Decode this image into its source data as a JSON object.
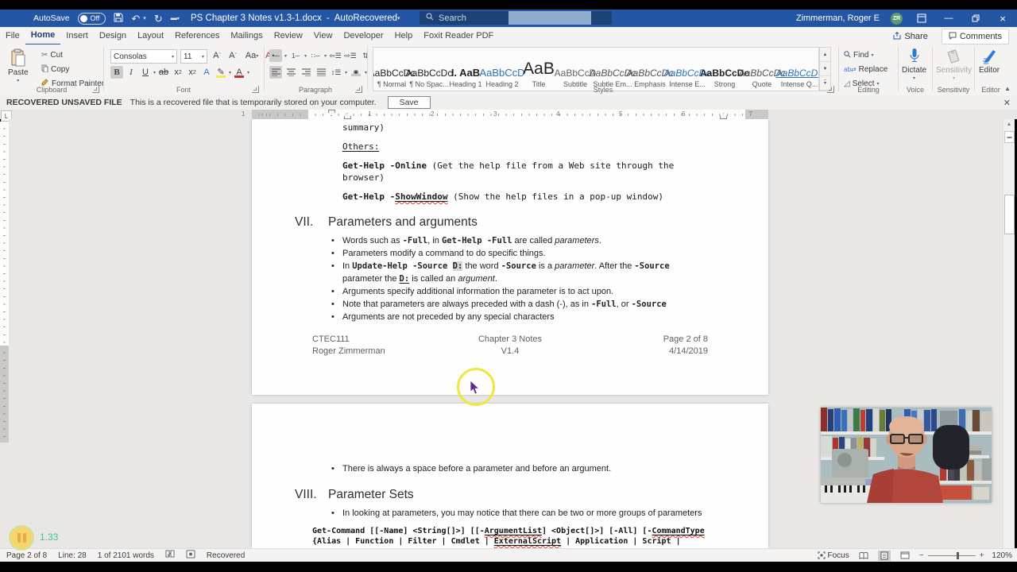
{
  "titlebar": {
    "autosave_label": "AutoSave",
    "autosave_state": "Off",
    "title": "PS Chapter 3 Notes v1.3-1.docx",
    "title_separator": "-",
    "title_suffix": "AutoRecovered",
    "search_placeholder": "Search",
    "user_name": "Zimmerman, Roger E",
    "user_initials": "ZR"
  },
  "tabs": {
    "items": [
      "File",
      "Home",
      "Insert",
      "Design",
      "Layout",
      "References",
      "Mailings",
      "Review",
      "View",
      "Developer",
      "Help",
      "Foxit Reader PDF"
    ],
    "active": "Home",
    "share_label": "Share",
    "comments_label": "Comments"
  },
  "ribbon": {
    "clipboard": {
      "label": "Clipboard",
      "paste": "Paste",
      "cut": "Cut",
      "copy": "Copy",
      "format_painter": "Format Painter"
    },
    "font": {
      "label": "Font",
      "family": "Consolas",
      "size": "11"
    },
    "paragraph": {
      "label": "Paragraph"
    },
    "styles": {
      "label": "Styles",
      "items": [
        {
          "preview": "AaBbCcDc",
          "name": "¶ Normal",
          "kind": "normal"
        },
        {
          "preview": "AaBbCcDc",
          "name": "¶ No Spac...",
          "kind": "normal"
        },
        {
          "preview": "I. AaB",
          "name": "Heading 1",
          "kind": "h1"
        },
        {
          "preview": "AaBbCcD",
          "name": "Heading 2",
          "kind": "h2"
        },
        {
          "preview": "AaB",
          "name": "Title",
          "kind": "title"
        },
        {
          "preview": "AaBbCcD",
          "name": "Subtitle",
          "kind": "subtitle"
        },
        {
          "preview": "AaBbCcDc",
          "name": "Subtle Em...",
          "kind": "it"
        },
        {
          "preview": "AaBbCcDc",
          "name": "Emphasis",
          "kind": "it"
        },
        {
          "preview": "AaBbCcDc",
          "name": "Intense E...",
          "kind": "itblue"
        },
        {
          "preview": "AaBbCcDc",
          "name": "Strong",
          "kind": "bold"
        },
        {
          "preview": "AaBbCcDc",
          "name": "Quote",
          "kind": "it"
        },
        {
          "preview": "AaBbCcDc",
          "name": "Intense Q...",
          "kind": "intq"
        }
      ]
    },
    "editing": {
      "label": "Editing",
      "find": "Find",
      "replace": "Replace",
      "select": "Select"
    },
    "voice": {
      "label": "Voice",
      "dictate": "Dictate"
    },
    "sensitivity": {
      "label": "Sensitivity",
      "button": "Sensitivity"
    },
    "editor": {
      "label": "Editor",
      "button": "Editor"
    }
  },
  "recovered_bar": {
    "title": "RECOVERED UNSAVED FILE",
    "message": "This is a recovered file that is temporarily stored on your computer.",
    "save_label": "Save"
  },
  "ruler": {
    "left_margin_number": "1",
    "numbers": [
      "1",
      "2",
      "3",
      "4",
      "5",
      "6"
    ],
    "right_margin_number": "7",
    "tab_selector": "L"
  },
  "document": {
    "page1_blocks": [
      {
        "type": "mono",
        "cls": "first",
        "lines": [
          [
            {
              "t": "summary)"
            }
          ]
        ]
      },
      {
        "type": "mono",
        "lines": [
          [
            {
              "t": "Others:",
              "u": 1
            }
          ]
        ]
      },
      {
        "type": "mono",
        "lines": [
          [
            {
              "t": "Get-Help -Online",
              "b": 1
            },
            {
              "t": " (Get the help file from a Web site through the"
            }
          ],
          [
            {
              "t": "browser)"
            }
          ]
        ]
      },
      {
        "type": "mono",
        "lines": [
          [
            {
              "t": "Get-Help -",
              "b": 1
            },
            {
              "t": "ShowWindow",
              "b": 1,
              "u": 1,
              "sq": 1
            },
            {
              "t": " (Show the help files in a pop-up window)"
            }
          ]
        ]
      },
      {
        "type": "heading",
        "num": "VII.",
        "text": "Parameters and arguments"
      },
      {
        "type": "bullets",
        "items": [
          {
            "lines": [
              [
                {
                  "t": "Words such as "
                },
                {
                  "t": "-Full",
                  "m": 1
                },
                {
                  "t": ", in "
                },
                {
                  "t": "Get-Help -Full",
                  "m": 1
                },
                {
                  "t": " are called "
                },
                {
                  "t": "parameters",
                  "i": 1
                },
                {
                  "t": "."
                }
              ]
            ]
          },
          {
            "lines": [
              [
                {
                  "t": "Parameters modify a command to do specific things."
                }
              ]
            ]
          },
          {
            "lines": [
              [
                {
                  "t": "In "
                },
                {
                  "t": "Update-Help -Source ",
                  "m": 1
                },
                {
                  "t": "D:",
                  "m": 1,
                  "hl": 1
                },
                {
                  "t": " the word "
                },
                {
                  "t": "-Source",
                  "m": 1
                },
                {
                  "t": " is a "
                },
                {
                  "t": "parameter",
                  "i": 1
                },
                {
                  "t": ". After the "
                },
                {
                  "t": "-Source",
                  "m": 1
                }
              ],
              [
                {
                  "t": "parameter the "
                },
                {
                  "t": "D:",
                  "m": 1,
                  "u": 1
                },
                {
                  "t": " is called an "
                },
                {
                  "t": "argument",
                  "i": 1
                },
                {
                  "t": "."
                }
              ]
            ]
          },
          {
            "lines": [
              [
                {
                  "t": "Arguments specify additional information the parameter is to act upon."
                }
              ]
            ]
          },
          {
            "lines": [
              [
                {
                  "t": "Note that parameters are always preceded with a dash (-), as in "
                },
                {
                  "t": "-Full",
                  "m": 1
                },
                {
                  "t": ", or "
                },
                {
                  "t": "-Source",
                  "m": 1
                }
              ]
            ]
          },
          {
            "lines": [
              [
                {
                  "t": "Arguments are not preceded by any special characters"
                }
              ]
            ]
          }
        ]
      },
      {
        "type": "footer"
      }
    ],
    "page2_blocks": [
      {
        "type": "bullets",
        "cls": "page2-first",
        "items": [
          {
            "lines": [
              [
                {
                  "t": "There is always a space before a parameter and before an argument."
                }
              ]
            ]
          }
        ]
      },
      {
        "type": "heading",
        "num": "VIII.",
        "text": "Parameter Sets"
      },
      {
        "type": "bullets",
        "items": [
          {
            "lines": [
              [
                {
                  "t": "In looking at parameters, you may notice that there can be two or more groups of parameters"
                }
              ]
            ]
          }
        ]
      },
      {
        "type": "code",
        "lines": [
          [
            {
              "t": "Get-Command [[-Name] <String[]>] [[-"
            },
            {
              "t": "ArgumentList",
              "u": 1,
              "sq": 1
            },
            {
              "t": "] <Object[]>] [-All] [-"
            },
            {
              "t": "CommandType",
              "u": 1,
              "sq": 1
            }
          ],
          [
            {
              "t": "{Alias | Function | Filter | Cmdlet | "
            },
            {
              "t": "ExternalScript",
              "u": 1,
              "sq": 1
            },
            {
              "t": " | Application | Script |"
            }
          ]
        ]
      }
    ],
    "footer": {
      "rows": [
        [
          "CTEC111",
          "Chapter 3 Notes",
          "Page 2 of 8"
        ],
        [
          "Roger Zimmerman",
          "V1.4",
          "4/14/2019"
        ]
      ]
    }
  },
  "status_bar": {
    "page": "Page 2 of 8",
    "line": "Line: 28",
    "words": "1 of 2101 words",
    "recovered": "Recovered",
    "focus": "Focus",
    "zoom": "120%"
  },
  "recorder": {
    "time": "1.33"
  },
  "colors": {
    "titlebar": "#2456a3",
    "search_box": "#1d4376",
    "active_tab_underline": "#2456a3",
    "squiggle": "#e03e2d",
    "highlight_yellow": "#f0e63c",
    "accent_blue": "#2b7cd3"
  }
}
